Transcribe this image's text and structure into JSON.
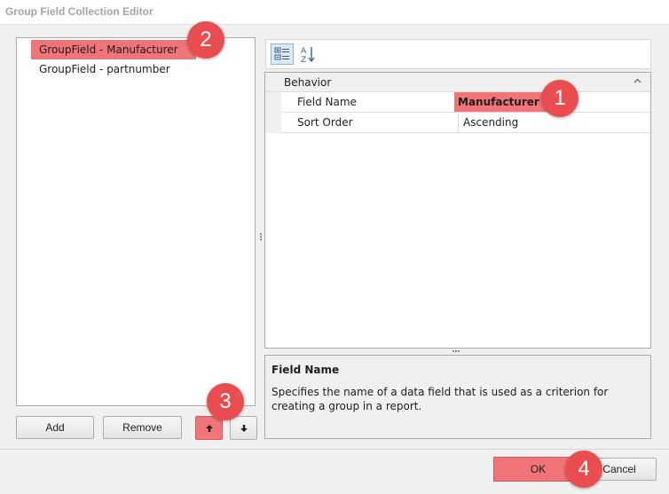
{
  "window": {
    "title": "Group Field Collection Editor"
  },
  "list": {
    "items": [
      {
        "label": "GroupField - Manufacturer",
        "selected": true
      },
      {
        "label": "GroupField - partnumber",
        "selected": false
      }
    ]
  },
  "buttons": {
    "add": "Add",
    "remove": "Remove",
    "move_up_icon": "arrow-up-icon",
    "move_down_icon": "arrow-down-icon",
    "ok": "OK",
    "cancel": "Cancel"
  },
  "toolbar": {
    "categorized_icon": "categorized-icon",
    "alphabetical_icon": "sort-alphabetical-icon"
  },
  "property_grid": {
    "category": "Behavior",
    "rows": [
      {
        "name": "Field Name",
        "value": "Manufacturer"
      },
      {
        "name": "Sort Order",
        "value": "Ascending"
      }
    ]
  },
  "description": {
    "title": "Field Name",
    "text": "Specifies the name of a data field that is used as a criterion for creating a group in a report."
  },
  "badges": [
    "1",
    "2",
    "3",
    "4"
  ],
  "colors": {
    "highlight": "#f07478",
    "badge": "#ea4d4f"
  }
}
